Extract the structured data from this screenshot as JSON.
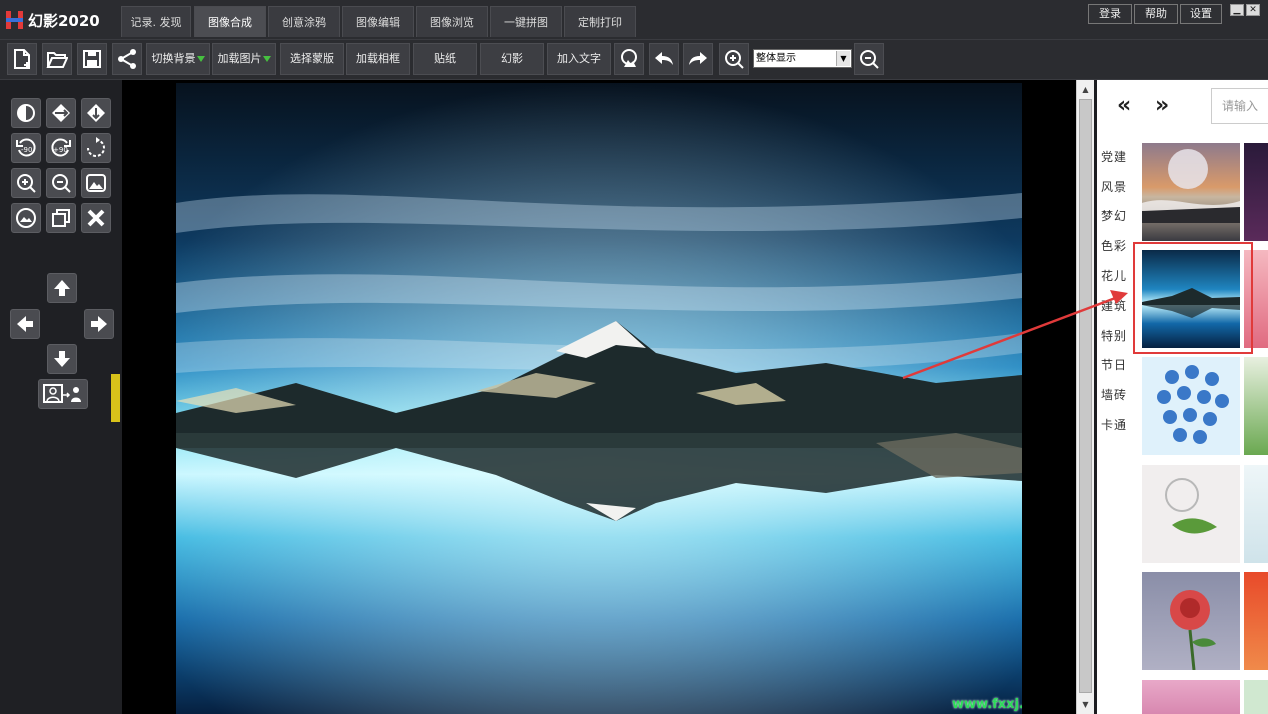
{
  "app": {
    "logo_text": "幻影2020"
  },
  "tabs": [
    {
      "label": "记录. 发现"
    },
    {
      "label": "图像合成"
    },
    {
      "label": "创意涂鸦"
    },
    {
      "label": "图像编辑"
    },
    {
      "label": "图像浏览"
    },
    {
      "label": "一键拼图"
    },
    {
      "label": "定制打印"
    }
  ],
  "top_buttons": {
    "login": "登录",
    "help": "帮助",
    "settings": "设置"
  },
  "toolbar": {
    "switch_bg": "切换背景",
    "load_image": "加载图片",
    "select_mask": "选择蒙版",
    "load_frame": "加载相框",
    "sticker": "贴纸",
    "phantom": "幻影",
    "add_text": "加入文字",
    "zoom_select_value": "整体显示"
  },
  "canvas": {
    "watermark": "www.fxxj.com"
  },
  "right_panel": {
    "prev": "«",
    "next": "»",
    "search_placeholder": "请输入",
    "categories": [
      "党建",
      "风景",
      "梦幻",
      "色彩",
      "花儿",
      "建筑",
      "特别",
      "节日",
      "墙砖",
      "卡通"
    ]
  },
  "colors": {
    "accent_tab_active": "#4c4d52",
    "highlight_border": "#e03a3a",
    "dropdown_triangle": "#46c040",
    "watermark": "#2ddc5a"
  }
}
